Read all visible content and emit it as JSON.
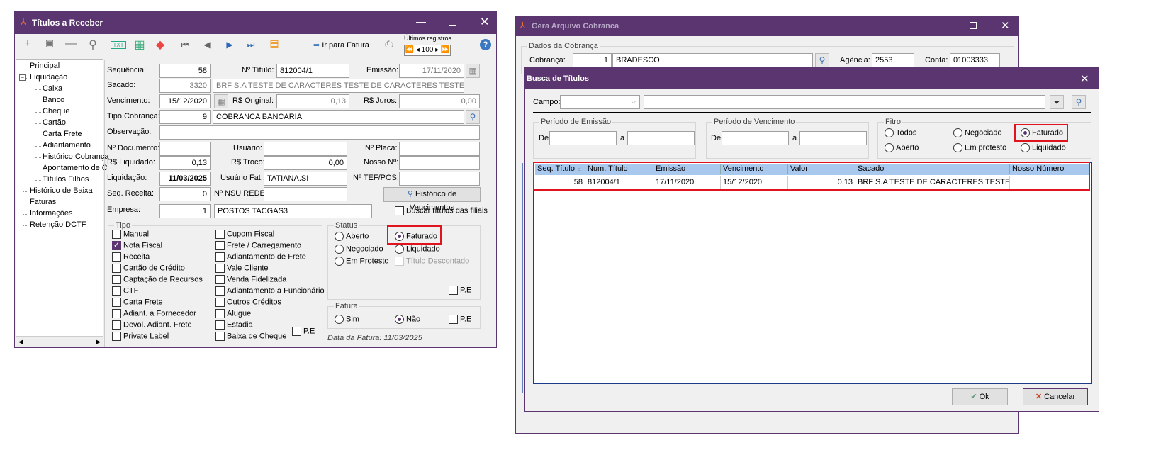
{
  "left_window": {
    "title": "Títulos a Receber",
    "toolbar": {
      "add": "plus-icon",
      "save": "save-icon",
      "remove": "minus-icon",
      "search": "search-icon",
      "txt": "TXT",
      "ir_para_fatura": "Ir para Fatura",
      "ultimos_registros": "Últimos registros",
      "pager_value": "100"
    },
    "tree": [
      {
        "label": "Principal",
        "level": 0
      },
      {
        "label": "Liquidação",
        "level": 0,
        "expander": "⊟"
      },
      {
        "label": "Caixa",
        "level": 1
      },
      {
        "label": "Banco",
        "level": 1
      },
      {
        "label": "Cheque",
        "level": 1
      },
      {
        "label": "Cartão",
        "level": 1
      },
      {
        "label": "Carta Frete",
        "level": 1
      },
      {
        "label": "Adiantamento",
        "level": 1
      },
      {
        "label": "Histórico Cobrança",
        "level": 1
      },
      {
        "label": "Apontamento de C",
        "level": 1
      },
      {
        "label": "Títulos Filhos",
        "level": 1
      },
      {
        "label": "Histórico de Baixa",
        "level": 0
      },
      {
        "label": "Faturas",
        "level": 0
      },
      {
        "label": "Informações",
        "level": 0
      },
      {
        "label": "Retenção DCTF",
        "level": 0
      }
    ],
    "form": {
      "sequencia_label": "Sequência:",
      "sequencia": "58",
      "titulo_label": "Nº Título:",
      "titulo": "812004/1",
      "emissao_label": "Emissão:",
      "emissao": "17/11/2020",
      "sacado_label": "Sacado:",
      "sacado_code": "3320",
      "sacado_name": "BRF S.A TESTE DE CARACTERES TESTE DE CARACTERES TESTE DE CAR",
      "vencimento_label": "Vencimento:",
      "vencimento": "15/12/2020",
      "original_label": "R$ Original:",
      "original": "0,13",
      "juros_label": "R$ Juros:",
      "juros": "0,00",
      "tipo_cobranca_label": "Tipo Cobrança:",
      "tipo_cobranca_code": "9",
      "tipo_cobranca_name": "COBRANCA BANCARIA",
      "observacao_label": "Observação:",
      "observacao": "",
      "documento_label": "Nº Documento:",
      "documento": "",
      "usuario_label": "Usuário:",
      "usuario": "",
      "placa_label": "Nº Placa:",
      "placa": "",
      "liquidado_label": "R$ Liquidado:",
      "liquidado": "0,13",
      "troco_label": "R$ Troco:",
      "troco": "0,00",
      "nosso_label": "Nosso Nº:",
      "nosso": "",
      "liquidacao_label": "Liquidação:",
      "liquidacao": "11/03/2025",
      "usuario_fat_label": "Usuário Fat.:",
      "usuario_fat": "TATIANA.SI",
      "tef_label": "Nº TEF/POS:",
      "tef": "",
      "seq_receita_label": "Seq. Receita:",
      "seq_receita": "0",
      "nsu_label": "Nº NSU REDE:",
      "nsu": "",
      "historico_venc_button": "Histórico de Vencimentos",
      "empresa_label": "Empresa:",
      "empresa_code": "1",
      "empresa_name": "POSTOS TACGAS3",
      "buscar_filiais": "Buscar títulos das filiais"
    },
    "tipo": {
      "title": "Tipo",
      "col1": [
        {
          "label": "Manual",
          "checked": false
        },
        {
          "label": "Nota Fiscal",
          "checked": true
        },
        {
          "label": "Receita",
          "checked": false
        },
        {
          "label": "Cartão de Crédito",
          "checked": false
        },
        {
          "label": "Captação de Recursos",
          "checked": false
        },
        {
          "label": "CTF",
          "checked": false
        },
        {
          "label": "Carta Frete",
          "checked": false
        },
        {
          "label": "Adiant. a Fornecedor",
          "checked": false
        },
        {
          "label": "Devol. Adiant. Frete",
          "checked": false
        },
        {
          "label": "Private Label",
          "checked": false
        }
      ],
      "col2": [
        {
          "label": "Cupom Fiscal",
          "checked": false
        },
        {
          "label": "Frete / Carregamento",
          "checked": false
        },
        {
          "label": "Adiantamento de Frete",
          "checked": false
        },
        {
          "label": "Vale Cliente",
          "checked": false
        },
        {
          "label": "Venda Fidelizada",
          "checked": false
        },
        {
          "label": "Adiantamento a Funcionário",
          "checked": false
        },
        {
          "label": "Outros Créditos",
          "checked": false
        },
        {
          "label": "Aluguel",
          "checked": false
        },
        {
          "label": "Estadia",
          "checked": false
        },
        {
          "label": "Baixa de Cheque",
          "checked": false
        }
      ],
      "pe": "P.E"
    },
    "status": {
      "title": "Status",
      "aberto": "Aberto",
      "faturado": "Faturado",
      "negociado": "Negociado",
      "liquidado": "Liquidado",
      "em_protesto": "Em Protesto",
      "titulo_descontado": "Título Descontado",
      "pe": "P.E",
      "selected": "Faturado"
    },
    "fatura": {
      "title": "Fatura",
      "sim": "Sim",
      "nao": "Não",
      "pe": "P.E",
      "selected": "Não",
      "data_fatura": "Data da Fatura: 11/03/2025"
    }
  },
  "gera_window": {
    "title": "Gera Arquivo Cobranca",
    "dados_title": "Dados da Cobrança",
    "cobranca_label": "Cobrança:",
    "cobranca_code": "1",
    "cobranca_name": "BRADESCO",
    "agencia_label": "Agência:",
    "agencia": "2553",
    "conta_label": "Conta:",
    "conta": "01003333"
  },
  "busca_dialog": {
    "title": "Busca de Títulos",
    "campo_label": "Campo:",
    "campo_value": "",
    "search_value": "",
    "emissao_title": "Período de Emissão",
    "vencimento_title": "Período de Vencimento",
    "de": "De",
    "a": "a",
    "filtro": {
      "title": "Fitro",
      "options": [
        "Todos",
        "Negociado",
        "Faturado",
        "Aberto",
        "Em protesto",
        "Liquidado"
      ],
      "selected": "Faturado"
    },
    "grid": {
      "columns": [
        "Seq. Título",
        "Num. Título",
        "Emissão",
        "Vencimento",
        "Valor",
        "Sacado",
        "Nosso Número"
      ],
      "rows": [
        [
          "58",
          "812004/1",
          "17/11/2020",
          "15/12/2020",
          "0,13",
          "BRF S.A TESTE DE CARACTERES TESTE DE CAR",
          ""
        ]
      ]
    },
    "ok": "Ok",
    "cancelar": "Cancelar"
  },
  "colors": {
    "title_bar": "#5b356f",
    "highlight": "#e0141e",
    "grid_header": "#a9c8ee"
  }
}
